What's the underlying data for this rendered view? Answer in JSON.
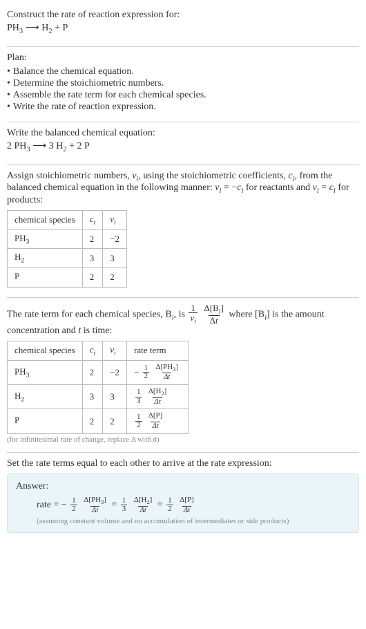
{
  "header": {
    "prompt": "Construct the rate of reaction expression for:",
    "eq_left": "PH",
    "eq_left_sub": "3",
    "arrow": "⟶",
    "eq_right_a": "H",
    "eq_right_a_sub": "2",
    "plus": " + ",
    "eq_right_b": "P"
  },
  "plan": {
    "title": "Plan:",
    "items": [
      "Balance the chemical equation.",
      "Determine the stoichiometric numbers.",
      "Assemble the rate term for each chemical species.",
      "Write the rate of reaction expression."
    ]
  },
  "balanced": {
    "title": "Write the balanced chemical equation:",
    "c1": "2 PH",
    "c1_sub": "3",
    "arrow": "⟶",
    "c2": "3 H",
    "c2_sub": "2",
    "plus": " + ",
    "c3": "2 P"
  },
  "stoich": {
    "intro_a": "Assign stoichiometric numbers, ",
    "nu": "ν",
    "nu_sub": "i",
    "intro_b": ", using the stoichiometric coefficients, ",
    "c": "c",
    "c_sub": "i",
    "intro_c": ", from the balanced chemical equation in the following manner: ",
    "rel1_a": "ν",
    "rel1_sub": "i",
    "rel1_b": " = −",
    "rel1_c": "c",
    "rel1_csub": "i",
    "intro_d": " for reactants and ",
    "rel2_a": "ν",
    "rel2_sub": "i",
    "rel2_b": " = ",
    "rel2_c": "c",
    "rel2_csub": "i",
    "intro_e": " for products:",
    "headers": {
      "species": "chemical species",
      "ci": "c",
      "ci_sub": "i",
      "vi": "ν",
      "vi_sub": "i"
    },
    "rows": [
      {
        "sp": "PH",
        "sp_sub": "3",
        "ci": "2",
        "vi": "−2"
      },
      {
        "sp": "H",
        "sp_sub": "2",
        "ci": "3",
        "vi": "3"
      },
      {
        "sp": "P",
        "sp_sub": "",
        "ci": "2",
        "vi": "2"
      }
    ]
  },
  "rate_term": {
    "intro_a": "The rate term for each chemical species, B",
    "intro_a_sub": "i",
    "intro_b": ", is ",
    "one": "1",
    "nu": "ν",
    "nu_sub": "i",
    "delta_top": "Δ[B",
    "delta_top_sub": "i",
    "delta_top_close": "]",
    "delta_bot": "Δt",
    "intro_c": " where [B",
    "intro_c_sub": "i",
    "intro_d": "] is the amount concentration and ",
    "t": "t",
    "intro_e": " is time:",
    "headers": {
      "species": "chemical species",
      "ci": "c",
      "ci_sub": "i",
      "vi": "ν",
      "vi_sub": "i",
      "rate": "rate term"
    },
    "rows": [
      {
        "sp": "PH",
        "sp_sub": "3",
        "ci": "2",
        "vi": "−2",
        "sign": "−",
        "fn": "1",
        "fd": "2",
        "dn_a": "Δ[PH",
        "dn_sub": "3",
        "dn_b": "]",
        "dd": "Δt"
      },
      {
        "sp": "H",
        "sp_sub": "2",
        "ci": "3",
        "vi": "3",
        "sign": "",
        "fn": "1",
        "fd": "3",
        "dn_a": "Δ[H",
        "dn_sub": "2",
        "dn_b": "]",
        "dd": "Δt"
      },
      {
        "sp": "P",
        "sp_sub": "",
        "ci": "2",
        "vi": "2",
        "sign": "",
        "fn": "1",
        "fd": "2",
        "dn_a": "Δ[P",
        "dn_sub": "",
        "dn_b": "]",
        "dd": "Δt"
      }
    ],
    "note": "(for infinitesimal rate of change, replace Δ with d)"
  },
  "final": {
    "title": "Set the rate terms equal to each other to arrive at the rate expression:"
  },
  "answer": {
    "label": "Answer:",
    "rate": "rate = ",
    "neg": "−",
    "t1": {
      "fn": "1",
      "fd": "2",
      "dn": "Δ[PH",
      "dn_sub": "3",
      "dn_b": "]",
      "dd": "Δt"
    },
    "eq": " = ",
    "t2": {
      "fn": "1",
      "fd": "3",
      "dn": "Δ[H",
      "dn_sub": "2",
      "dn_b": "]",
      "dd": "Δt"
    },
    "t3": {
      "fn": "1",
      "fd": "2",
      "dn": "Δ[P",
      "dn_sub": "",
      "dn_b": "]",
      "dd": "Δt"
    },
    "note": "(assuming constant volume and no accumulation of intermediates or side products)"
  }
}
